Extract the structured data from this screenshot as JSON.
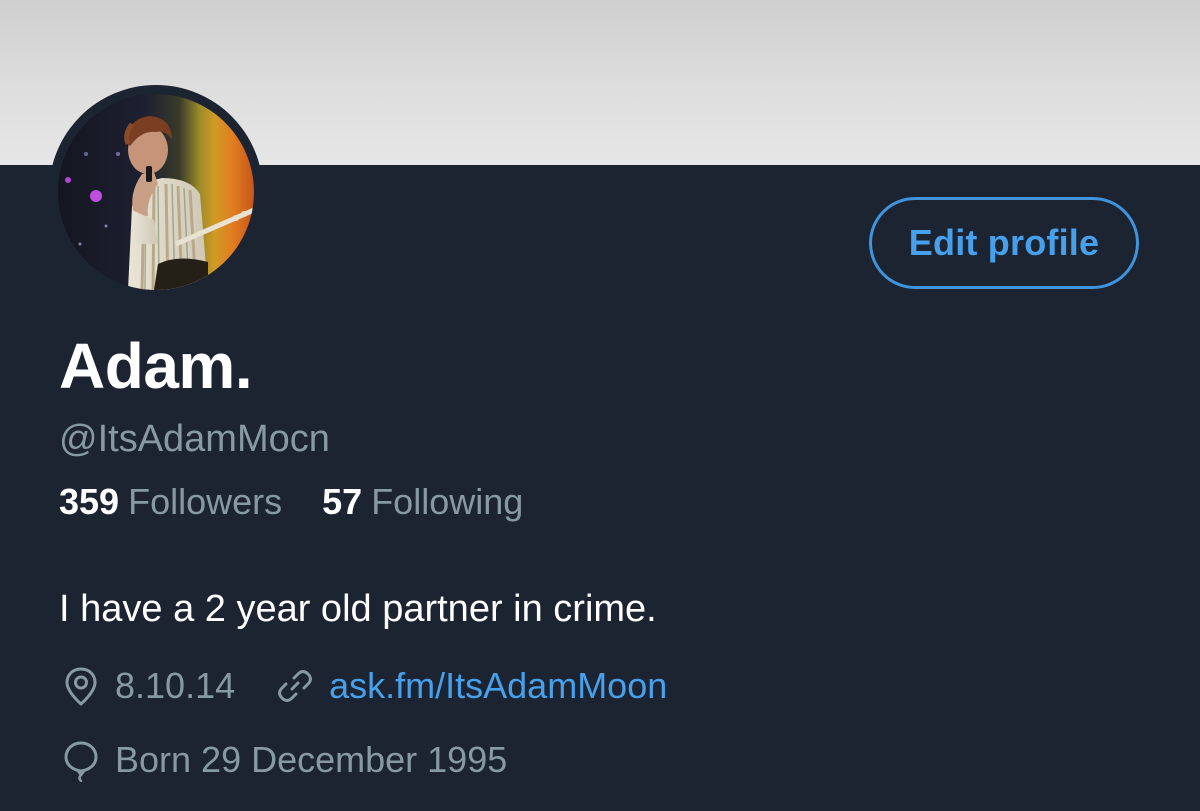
{
  "profile": {
    "display_name": "Adam.",
    "handle": "@ItsAdamMocn",
    "bio": "I have a 2 year old partner in crime.",
    "edit_button_label": "Edit profile",
    "stats": {
      "followers_count": "359",
      "followers_label": "Followers",
      "following_count": "57",
      "following_label": "Following"
    },
    "location": "8.10.14",
    "website": "ask.fm/ItsAdamMoon",
    "birthday": "Born 29 December 1995"
  },
  "icons": {
    "location": "location-pin-icon",
    "link": "link-icon",
    "birthday": "balloon-icon"
  },
  "colors": {
    "background": "#1c2431",
    "accent": "#47a0eb",
    "secondary_text": "#8899a6",
    "primary_text": "#ffffff",
    "banner": "#dedede"
  }
}
